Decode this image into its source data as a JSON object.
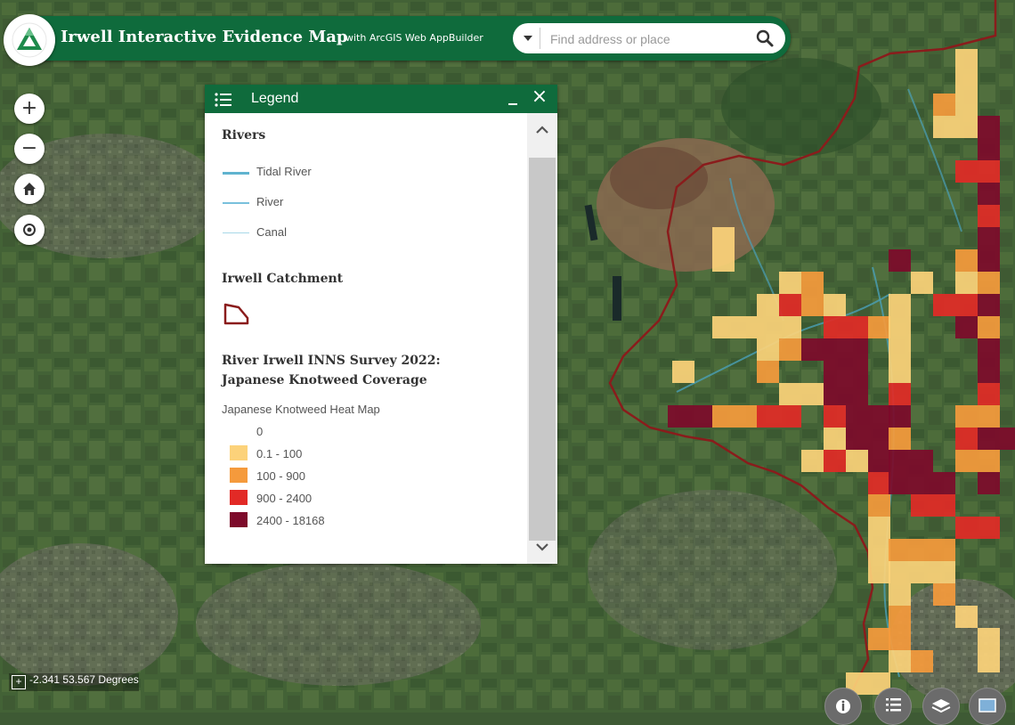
{
  "app": {
    "title": "Irwell Interactive Evidence Map",
    "subtitle": "with ArcGIS Web AppBuilder",
    "logo_icon": "triangle-logo-icon"
  },
  "search": {
    "placeholder": "Find address or place",
    "value": ""
  },
  "map_tools": [
    {
      "name": "zoom-in-button",
      "glyph": "+"
    },
    {
      "name": "zoom-out-button",
      "glyph": "−"
    },
    {
      "name": "home-button",
      "icon": "home-icon"
    },
    {
      "name": "locate-button",
      "icon": "locate-icon"
    }
  ],
  "legend": {
    "panel_title": "Legend",
    "sections": [
      {
        "title": "Rivers",
        "items": [
          {
            "label": "Tidal River",
            "color": "#5fb3cf"
          },
          {
            "label": "River",
            "color": "#79c0dc"
          },
          {
            "label": "Canal",
            "color": "#a8d8e8"
          }
        ]
      },
      {
        "title": "Irwell Catchment",
        "outline_color": "#8a1c1c"
      },
      {
        "title_line1": "River Irwell INNS Survey 2022:",
        "title_line2": "Japanese Knotweed Coverage",
        "layer_name": "Japanese Knotweed Heat Map",
        "classes": [
          {
            "label": "0",
            "color": ""
          },
          {
            "label": "0.1 - 100",
            "color": "#fcd27a"
          },
          {
            "label": "100 - 900",
            "color": "#f59a3c"
          },
          {
            "label": "900 - 2400",
            "color": "#e22a26"
          },
          {
            "label": "2400 - 18168",
            "color": "#7d0a2a"
          }
        ]
      }
    ]
  },
  "coordinates": {
    "text": "-2.341 53.567 Degrees"
  },
  "bottom_widgets": [
    {
      "name": "about-button",
      "icon": "info-icon"
    },
    {
      "name": "legend-widget-button",
      "icon": "list-icon"
    },
    {
      "name": "layer-list-button",
      "icon": "layers-icon"
    },
    {
      "name": "basemap-button",
      "icon": "basemap-icon"
    }
  ],
  "colors": {
    "header_green": "#0f6b3c",
    "catchment_outline": "#8a1c1c"
  }
}
